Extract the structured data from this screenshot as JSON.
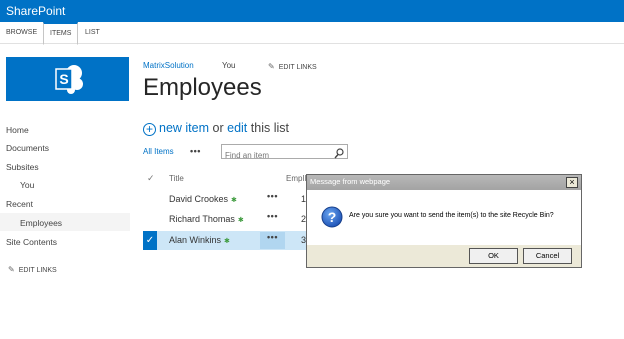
{
  "suitebar": {
    "brand": "SharePoint"
  },
  "ribbon": {
    "tabs": [
      {
        "label": "BROWSE"
      },
      {
        "label": "ITEMS"
      },
      {
        "label": "LIST"
      }
    ]
  },
  "topnav": {
    "site_link": "MatrixSolution",
    "you": "You",
    "edit_links": "EDIT LINKS"
  },
  "page": {
    "title": "Employees"
  },
  "quicklaunch": {
    "home": "Home",
    "documents": "Documents",
    "subsites": "Subsites",
    "you": "You",
    "recent": "Recent",
    "employees": "Employees",
    "site_contents": "Site Contents",
    "edit_links": "EDIT LINKS"
  },
  "commands": {
    "new_item": "new item",
    "or": "or",
    "edit": "edit",
    "this_list": "this list"
  },
  "view": {
    "all_items": "All Items",
    "ellipsis": "•••",
    "search_placeholder": "Find an item"
  },
  "table": {
    "headers": {
      "check": "✓",
      "title": "Title",
      "empid": "EmpID"
    },
    "rows": [
      {
        "title": "David Crookes",
        "dots": "•••",
        "id": "1"
      },
      {
        "title": "Richard Thomas",
        "dots": "•••",
        "id": "2"
      },
      {
        "title": "Alan Winkins",
        "dots": "•••",
        "id": "3"
      }
    ],
    "new_marker": "✱"
  },
  "dialog": {
    "title": "Message from webpage",
    "close": "×",
    "message": "Are you sure you want to send the item(s) to the site Recycle Bin?",
    "ok": "OK",
    "cancel": "Cancel"
  },
  "colors": {
    "brand": "#0072c6",
    "selected_row": "#cde6f7",
    "dialog_bg": "#ece9d8"
  }
}
